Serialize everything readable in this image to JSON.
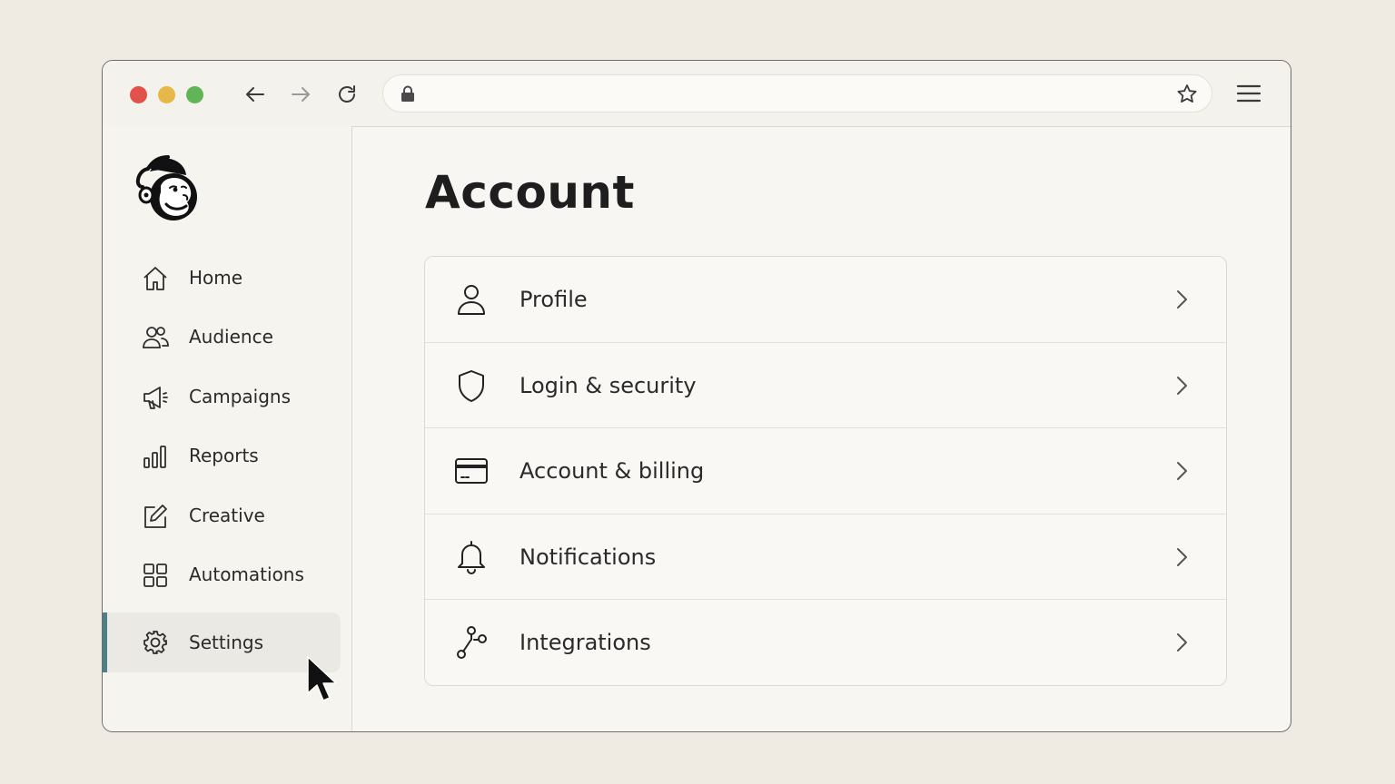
{
  "browser": {
    "url": "",
    "controls": {
      "back": "arrow-left-icon",
      "forward": "arrow-right-icon",
      "reload": "reload-icon",
      "bookmark": "star-icon",
      "menu": "hamburger-menu-icon"
    }
  },
  "sidebar": {
    "logo": "mailchimp-logo",
    "items": [
      {
        "label": "Home",
        "icon": "home-icon"
      },
      {
        "label": "Audience",
        "icon": "audience-icon"
      },
      {
        "label": "Campaigns",
        "icon": "megaphone-icon"
      },
      {
        "label": "Reports",
        "icon": "bar-chart-icon"
      },
      {
        "label": "Creative",
        "icon": "edit-icon"
      },
      {
        "label": "Automations",
        "icon": "grid-icon"
      },
      {
        "label": "Settings",
        "icon": "gear-icon",
        "active": true
      }
    ]
  },
  "main": {
    "title": "Account",
    "rows": [
      {
        "label": "Profile",
        "icon": "user-icon"
      },
      {
        "label": "Login & security",
        "icon": "shield-icon"
      },
      {
        "label": "Account & billing",
        "icon": "credit-card-icon"
      },
      {
        "label": "Notifications",
        "icon": "bell-icon"
      },
      {
        "label": "Integrations",
        "icon": "integrations-icon"
      }
    ]
  },
  "colors": {
    "background": "#efebe2",
    "accent": "#4d7f86",
    "traffic_red": "#e0524a",
    "traffic_yellow": "#e6b847",
    "traffic_green": "#62b556"
  }
}
